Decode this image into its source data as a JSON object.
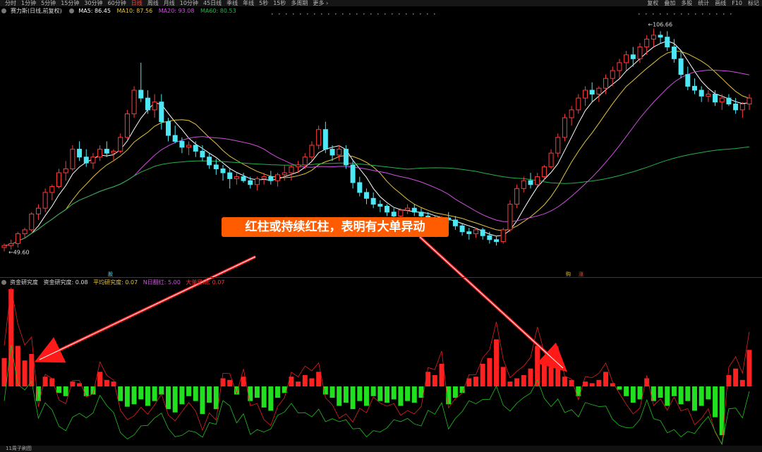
{
  "toolbar": {
    "periods": [
      "分时",
      "1分钟",
      "5分钟",
      "15分钟",
      "30分钟",
      "60分钟",
      "日线",
      "周线",
      "月线",
      "10分钟",
      "45日线",
      "季线",
      "年线",
      "5秒",
      "15秒",
      "多周期",
      "更多 ›"
    ],
    "active_period": "日线",
    "tools": [
      "复权",
      "叠加",
      "多股",
      "统计",
      "画线",
      "F10",
      "标记"
    ]
  },
  "main_legend": {
    "title": "赛力斯(日线,前复权)",
    "ma5": "MA5: 86.45",
    "ma10": "MA10: 87.56",
    "ma20": "MA20: 93.08",
    "ma60": "MA60: 80.53",
    "colors": {
      "ma5": "#ffffff",
      "ma10": "#e6c33a",
      "ma20": "#d14ee0",
      "ma60": "#22b34a"
    }
  },
  "price_labels": {
    "high": "106.66",
    "low": "49.60"
  },
  "markers": {
    "event1": "股",
    "event2": "购",
    "event3": "涨"
  },
  "indicator_legend": {
    "name": "资金研究度",
    "v1": "资金研究度: 0.08",
    "v2": "平均研究度: 0.07",
    "v3": "N日翻红: 5.00",
    "v4": "大单异动: 0.07"
  },
  "annotation": "红柱或持续红柱，表明有大单异动",
  "bottom": {
    "tab": "11周子刷图"
  },
  "chart_data": {
    "type": "candlestick",
    "series": [
      {
        "name": "MA5",
        "color": "#ffffff"
      },
      {
        "name": "MA10",
        "color": "#e6c33a"
      },
      {
        "name": "MA20",
        "color": "#d14ee0"
      },
      {
        "name": "MA60",
        "color": "#22b34a"
      }
    ],
    "ohlc": [
      [
        51,
        52,
        50,
        51.5
      ],
      [
        51.5,
        53,
        50.5,
        52
      ],
      [
        52,
        55,
        51,
        54.5
      ],
      [
        54.5,
        56,
        53.5,
        55.5
      ],
      [
        55.5,
        60,
        55,
        59.5
      ],
      [
        59.5,
        62,
        58,
        61
      ],
      [
        61,
        66,
        60,
        65
      ],
      [
        65,
        67,
        63,
        66.5
      ],
      [
        66.5,
        71,
        66,
        70
      ],
      [
        70,
        73,
        68,
        71
      ],
      [
        71,
        77,
        70.5,
        76
      ],
      [
        76,
        78,
        73,
        74
      ],
      [
        74,
        76,
        71.5,
        72.5
      ],
      [
        72.5,
        75,
        71,
        74
      ],
      [
        74,
        77,
        73,
        76
      ],
      [
        76,
        78,
        74,
        75
      ],
      [
        75,
        76,
        73,
        75.5
      ],
      [
        75.5,
        80,
        75,
        79
      ],
      [
        79,
        86,
        78.5,
        85
      ],
      [
        85,
        92,
        84,
        91
      ],
      [
        91,
        98,
        88,
        89
      ],
      [
        89,
        91,
        85,
        86
      ],
      [
        86,
        90,
        84,
        88
      ],
      [
        88,
        90,
        81,
        83
      ],
      [
        83,
        84,
        78,
        79.5
      ],
      [
        79.5,
        82,
        77.5,
        78
      ],
      [
        78,
        79,
        75,
        76.5
      ],
      [
        76.5,
        78,
        74.5,
        77
      ],
      [
        77,
        78,
        74,
        75.5
      ],
      [
        75.5,
        77,
        73,
        74
      ],
      [
        74,
        75,
        71,
        72
      ],
      [
        72,
        73.5,
        69.5,
        71
      ],
      [
        71,
        72,
        68,
        70
      ],
      [
        70,
        71,
        66,
        68.5
      ],
      [
        68.5,
        70,
        67,
        69
      ],
      [
        69,
        70,
        67.5,
        68
      ],
      [
        68,
        69,
        66,
        67
      ],
      [
        67,
        69,
        65.5,
        68.5
      ],
      [
        68.5,
        70,
        67,
        69
      ],
      [
        69,
        70.5,
        67,
        68
      ],
      [
        68,
        70,
        66.5,
        69.5
      ],
      [
        69.5,
        72,
        68,
        70
      ],
      [
        70,
        72,
        68,
        71.5
      ],
      [
        71.5,
        73,
        70,
        72
      ],
      [
        72,
        75,
        71,
        74
      ],
      [
        74,
        78,
        73,
        77
      ],
      [
        77,
        82,
        76,
        81
      ],
      [
        81,
        83,
        75,
        76
      ],
      [
        76,
        77,
        73,
        74.5
      ],
      [
        74.5,
        77,
        73,
        76
      ],
      [
        76,
        77,
        71,
        72
      ],
      [
        72,
        73,
        66,
        67.5
      ],
      [
        67.5,
        69,
        64,
        65
      ],
      [
        65,
        66,
        62,
        63.5
      ],
      [
        63.5,
        65,
        61,
        62
      ],
      [
        62,
        63,
        60,
        61.5
      ],
      [
        61.5,
        62,
        59,
        60
      ],
      [
        60,
        61,
        58,
        59
      ],
      [
        59,
        61,
        57.5,
        60.5
      ],
      [
        60.5,
        62,
        59.5,
        61
      ],
      [
        61,
        62,
        59,
        60
      ],
      [
        60,
        61,
        58,
        59
      ],
      [
        59,
        60,
        57,
        58
      ],
      [
        58,
        59,
        56,
        57.5
      ],
      [
        57.5,
        59,
        56.5,
        58.5
      ],
      [
        58.5,
        60,
        57,
        58
      ],
      [
        58,
        59,
        55.5,
        56.5
      ],
      [
        56.5,
        57,
        54,
        55
      ],
      [
        55,
        56,
        53,
        54.5
      ],
      [
        54.5,
        56,
        53.5,
        55.5
      ],
      [
        55.5,
        56,
        53,
        54
      ],
      [
        54,
        55,
        52,
        53
      ],
      [
        53,
        54,
        51.5,
        52.5
      ],
      [
        52.5,
        56,
        52,
        55.5
      ],
      [
        55.5,
        63,
        55,
        62
      ],
      [
        62,
        67,
        61,
        66
      ],
      [
        66,
        69,
        65,
        68
      ],
      [
        68,
        70,
        66,
        67
      ],
      [
        67,
        70,
        66.5,
        69
      ],
      [
        69,
        72,
        68,
        71.5
      ],
      [
        71.5,
        76,
        71,
        75
      ],
      [
        75,
        80,
        74,
        79
      ],
      [
        79,
        85,
        78,
        84
      ],
      [
        84,
        87,
        82,
        86
      ],
      [
        86,
        90,
        85,
        89
      ],
      [
        89,
        92,
        87,
        91
      ],
      [
        91,
        93,
        88,
        90
      ],
      [
        90,
        92,
        88,
        91.5
      ],
      [
        91.5,
        95,
        90,
        94
      ],
      [
        94,
        97,
        92,
        96
      ],
      [
        96,
        99,
        94,
        98
      ],
      [
        98,
        101,
        96,
        100
      ],
      [
        100,
        102,
        97,
        99
      ],
      [
        99,
        103,
        98,
        102
      ],
      [
        102,
        105,
        100,
        104
      ],
      [
        104,
        106.66,
        102,
        105
      ],
      [
        105,
        106,
        103,
        104.5
      ],
      [
        104.5,
        106,
        101,
        102
      ],
      [
        102,
        104,
        98,
        99
      ],
      [
        99,
        101,
        94,
        95
      ],
      [
        95,
        97,
        91,
        92
      ],
      [
        92,
        94,
        90,
        91
      ],
      [
        91,
        92,
        88,
        89.5
      ],
      [
        89.5,
        91,
        88,
        90
      ],
      [
        90,
        91,
        87,
        88
      ],
      [
        88,
        90,
        86,
        89
      ],
      [
        89,
        90,
        87,
        87.5
      ],
      [
        87.5,
        89,
        85,
        86
      ],
      [
        86,
        88,
        84,
        87.5
      ],
      [
        87.5,
        90,
        86,
        89
      ]
    ],
    "indicator": [
      0.035,
      0.12,
      0.05,
      0.032,
      0.04,
      -0.018,
      0.012,
      0.01,
      -0.008,
      -0.012,
      0.006,
      0.004,
      -0.012,
      -0.01,
      0.018,
      0.008,
      0.006,
      -0.018,
      -0.025,
      -0.022,
      -0.016,
      -0.024,
      -0.018,
      -0.01,
      -0.028,
      -0.032,
      -0.022,
      -0.012,
      -0.018,
      -0.034,
      -0.02,
      -0.028,
      0.01,
      0.008,
      -0.01,
      0.012,
      -0.018,
      -0.014,
      -0.026,
      -0.03,
      -0.014,
      -0.008,
      0.012,
      0.006,
      0.014,
      0.01,
      0.018,
      -0.01,
      -0.014,
      -0.024,
      -0.02,
      -0.028,
      -0.018,
      -0.024,
      -0.012,
      -0.018,
      -0.02,
      -0.016,
      -0.024,
      -0.018,
      -0.02,
      -0.014,
      0.018,
      0.014,
      0.028,
      -0.022,
      -0.014,
      -0.008,
      0.01,
      0.012,
      0.028,
      0.035,
      0.058,
      0.024,
      0.006,
      0.01,
      0.014,
      0.022,
      0.05,
      0.03,
      0.024,
      0.038,
      0.012,
      0.008,
      -0.012,
      0.006,
      0.004,
      0.008,
      0.018,
      0.004,
      -0.004,
      -0.012,
      -0.02,
      -0.016,
      0.01,
      -0.018,
      -0.014,
      -0.024,
      -0.012,
      -0.022,
      -0.018,
      -0.03,
      -0.024,
      -0.016,
      -0.038,
      -0.06,
      0.014,
      0.022,
      0.008,
      0.045
    ]
  }
}
